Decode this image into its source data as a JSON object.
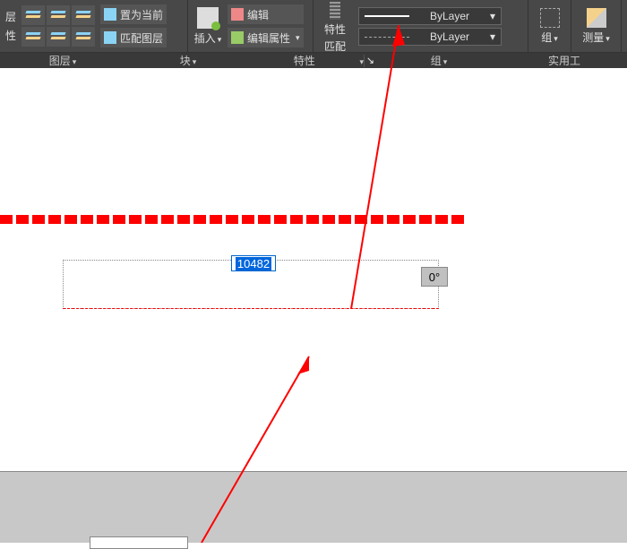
{
  "ribbon": {
    "layer_panel": {
      "left_label_top": "层",
      "left_label_bottom": "性",
      "set_current": "置为当前",
      "match_layer": "匹配图层",
      "title": "图层"
    },
    "block_panel": {
      "insert": "插入",
      "edit": "编辑",
      "edit_attrs": "编辑属性",
      "title": "块"
    },
    "props_panel": {
      "match_top": "特性",
      "match_bottom": "匹配",
      "lineweight": "ByLayer",
      "linetype": "ByLayer",
      "title": "特性"
    },
    "group_panel": {
      "group": "组",
      "title": "组"
    },
    "util_panel": {
      "measure": "测量",
      "title": "实用工"
    }
  },
  "canvas": {
    "dim_value": "10482",
    "angle_value": "0°"
  }
}
